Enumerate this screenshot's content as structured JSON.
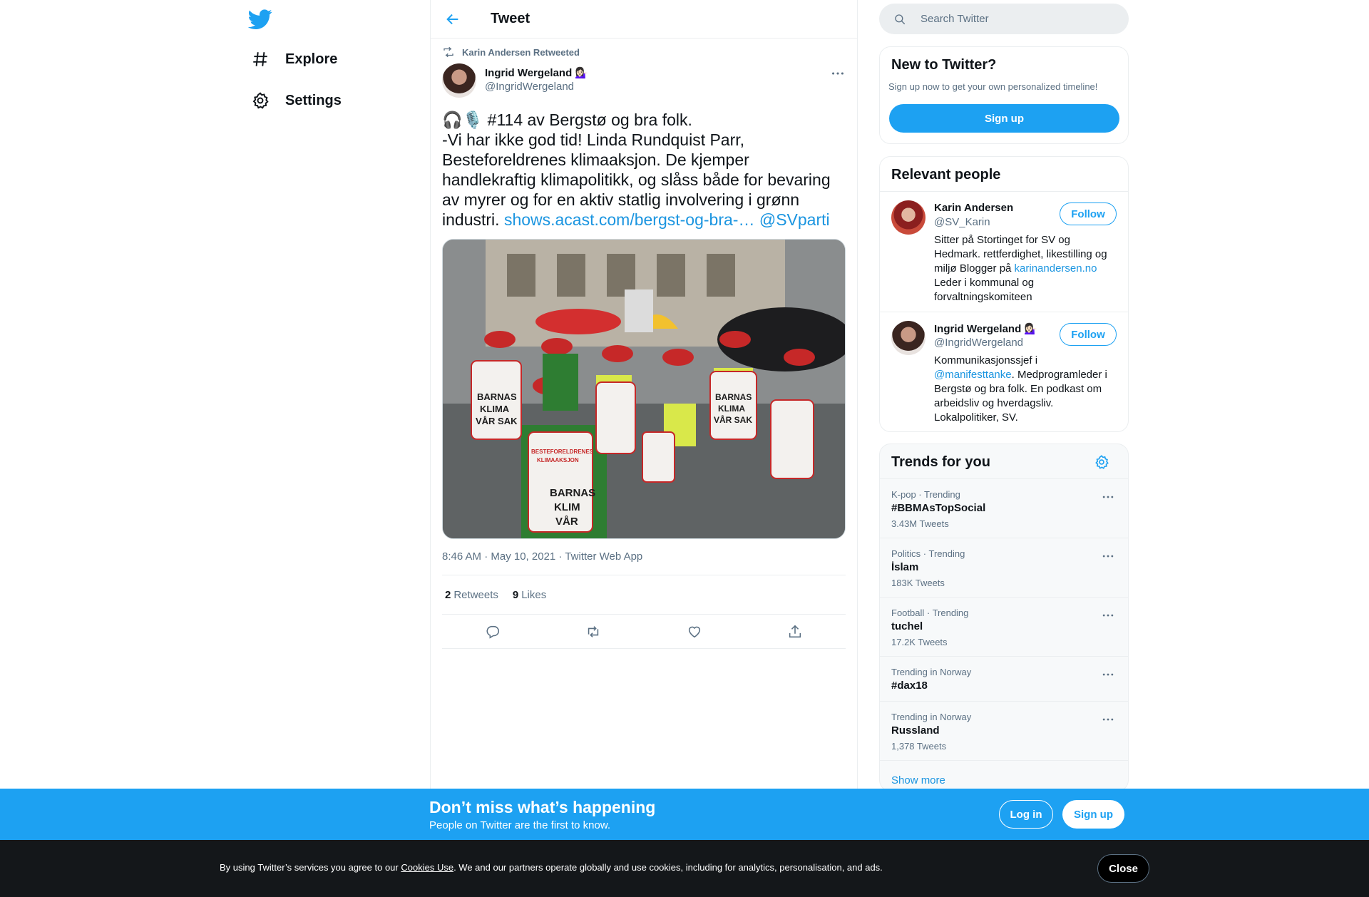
{
  "nav": {
    "items": [
      {
        "label": "Explore",
        "icon": "hashtag-icon"
      },
      {
        "label": "Settings",
        "icon": "gear-icon"
      }
    ]
  },
  "header": {
    "title": "Tweet"
  },
  "tweet": {
    "retweeted_by": "Karin Andersen Retweeted",
    "author_name": "Ingrid Wergeland 💁🏻‍♀️",
    "author_handle": "@IngridWergeland",
    "text_lines": [
      "🎧🎙️ #114 av Bergstø og bra folk.",
      "-Vi har ikke god tid! Linda Rundquist Parr,",
      "Besteforeldrenes klimaaksjon. De kjemper",
      "handlekraftig klimapolitikk, og slåss både for bevaring",
      "av myrer og for en aktiv statlig involvering i grønn"
    ],
    "text_last_prefix": "industri. ",
    "link": "shows.acast.com/bergst-og-bra-…",
    "mention": "@SVparti",
    "photo_signs": [
      "BARNAS KLIMA VÅR SAK",
      "BESTEFORELDRENES KLIMAAKSJON"
    ],
    "timestamp": "8:46 AM · May 10, 2021 · Twitter Web App",
    "retweets_count": "2",
    "retweets_label": "Retweets",
    "likes_count": "9",
    "likes_label": "Likes"
  },
  "search": {
    "placeholder": "Search Twitter"
  },
  "new_to_twitter": {
    "title": "New to Twitter?",
    "subtitle": "Sign up now to get your own personalized timeline!",
    "button": "Sign up"
  },
  "relevant_people": {
    "title": "Relevant people",
    "people": [
      {
        "name": "Karin Andersen",
        "handle": "@SV_Karin",
        "follow": "Follow",
        "bio_1": "Sitter på Stortinget for SV og Hedmark. rettferdighet, likestilling og miljø Blogger på ",
        "bio_link": "karinandersen.no",
        "bio_2": " Leder i kommunal og forvaltningskomiteen"
      },
      {
        "name": "Ingrid Wergeland 💁🏻‍♀️",
        "handle": "@IngridWergeland",
        "follow": "Follow",
        "bio_1": "Kommunikasjonssjef i ",
        "bio_link": "@manifesttanke",
        "bio_2": ". Medprogramleder i Bergstø og bra folk. En podkast om arbeidsliv og hverdagsliv. Lokalpolitiker, SV."
      }
    ]
  },
  "trends": {
    "title": "Trends for you",
    "items": [
      {
        "category": "K-pop · Trending",
        "name": "#BBMAsTopSocial",
        "count": "3.43M Tweets"
      },
      {
        "category": "Politics · Trending",
        "name": "İslam",
        "count": "183K Tweets"
      },
      {
        "category": "Football · Trending",
        "name": "tuchel",
        "count": "17.2K Tweets"
      },
      {
        "category": "Trending in Norway",
        "name": "#dax18",
        "count": ""
      },
      {
        "category": "Trending in Norway",
        "name": "Russland",
        "count": "1,378 Tweets"
      }
    ],
    "show_more": "Show more"
  },
  "banner": {
    "title": "Don’t miss what’s happening",
    "subtitle": "People on Twitter are the first to know.",
    "login": "Log in",
    "signup": "Sign up"
  },
  "cookie": {
    "prefix": "By using Twitter’s services you agree to our ",
    "link": "Cookies Use",
    "suffix": ". We and our partners operate globally and use cookies, including for analytics, personalisation, and ads.",
    "close": "Close"
  },
  "colors": {
    "accent": "#1da1f2",
    "link": "#1b95e0",
    "muted": "#5b7083",
    "banner": "#1da1f2",
    "cookie_bg": "#14171a"
  }
}
